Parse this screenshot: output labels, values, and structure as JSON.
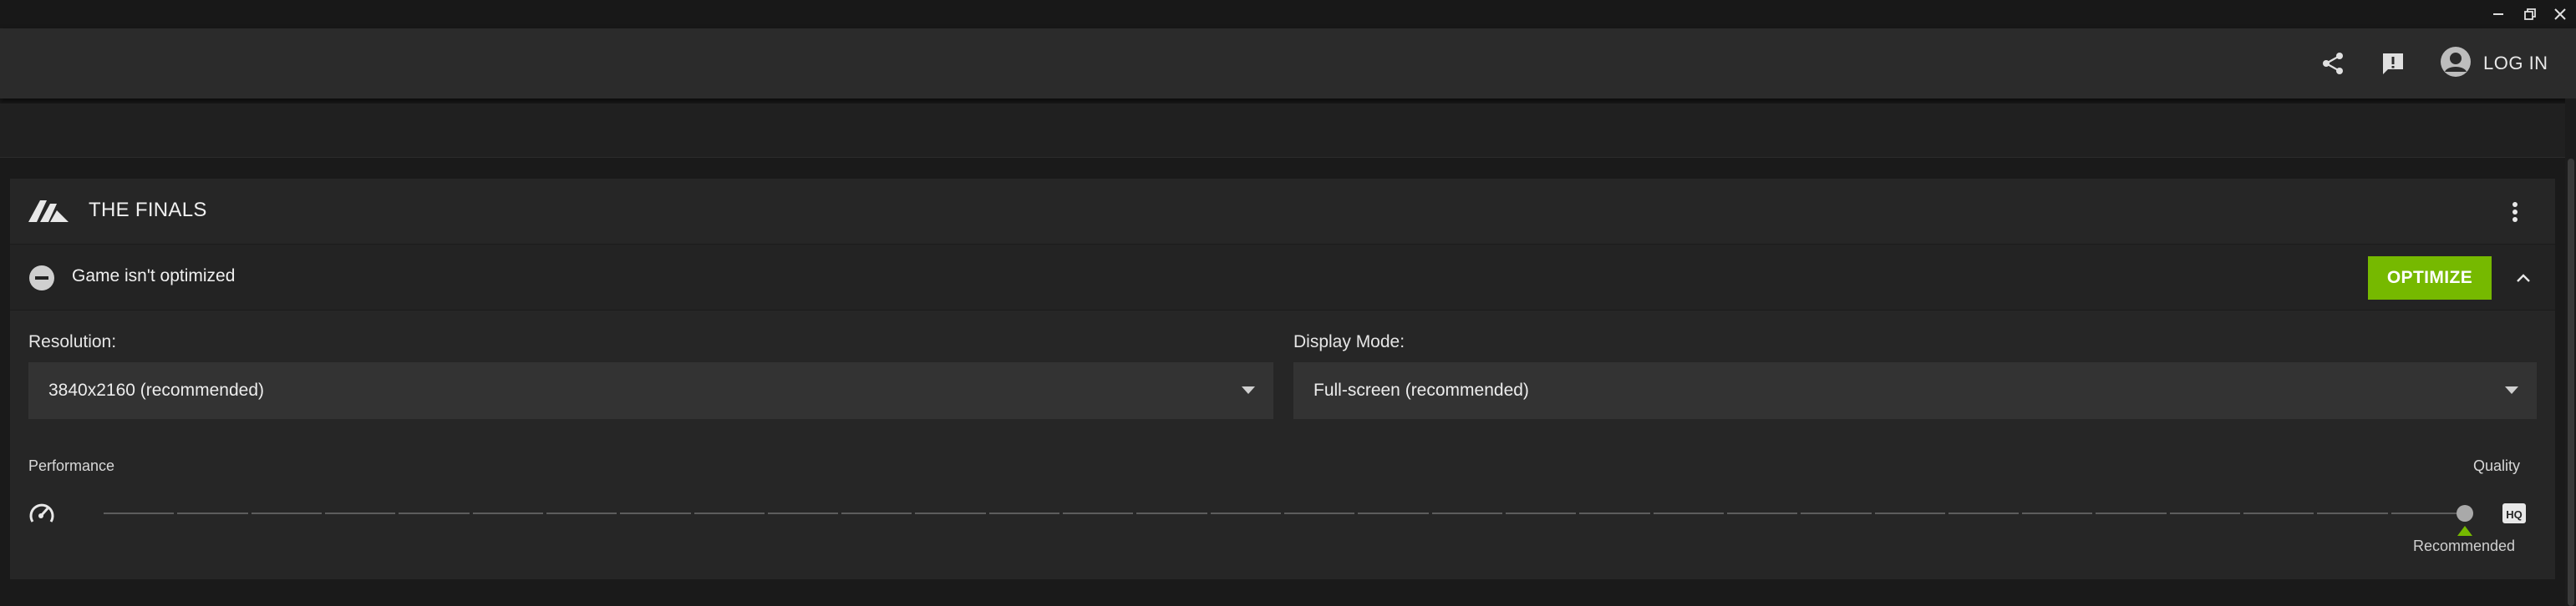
{
  "window": {
    "controls": [
      {
        "name": "minimize",
        "icon": "minimize-icon"
      },
      {
        "name": "restore",
        "icon": "restore-icon"
      },
      {
        "name": "close",
        "icon": "close-icon"
      }
    ]
  },
  "header": {
    "icons": [
      "share-icon",
      "feedback-icon",
      "user-avatar-icon"
    ],
    "login_label": "LOG IN"
  },
  "game": {
    "title": "THE FINALS",
    "logo_icon": "the-finals-logo",
    "status_text": "Game isn't optimized",
    "status_icon": "minus-circle-icon",
    "optimize_label": "OPTIMIZE"
  },
  "settings": {
    "resolution": {
      "label": "Resolution:",
      "value": "3840x2160 (recommended)"
    },
    "display_mode": {
      "label": "Display Mode:",
      "value": "Full-screen (recommended)"
    }
  },
  "slider": {
    "left_label": "Performance",
    "right_label": "Quality",
    "left_icon": "speedometer-icon",
    "right_icon": "hq-icon",
    "steps": 32,
    "current_step": 32,
    "recommended_step": 32,
    "recommended_label": "Recommended"
  },
  "colors": {
    "accent": "#76b900",
    "background": "#1a1a1a",
    "header": "#2b2b2b",
    "card": "#262626"
  }
}
